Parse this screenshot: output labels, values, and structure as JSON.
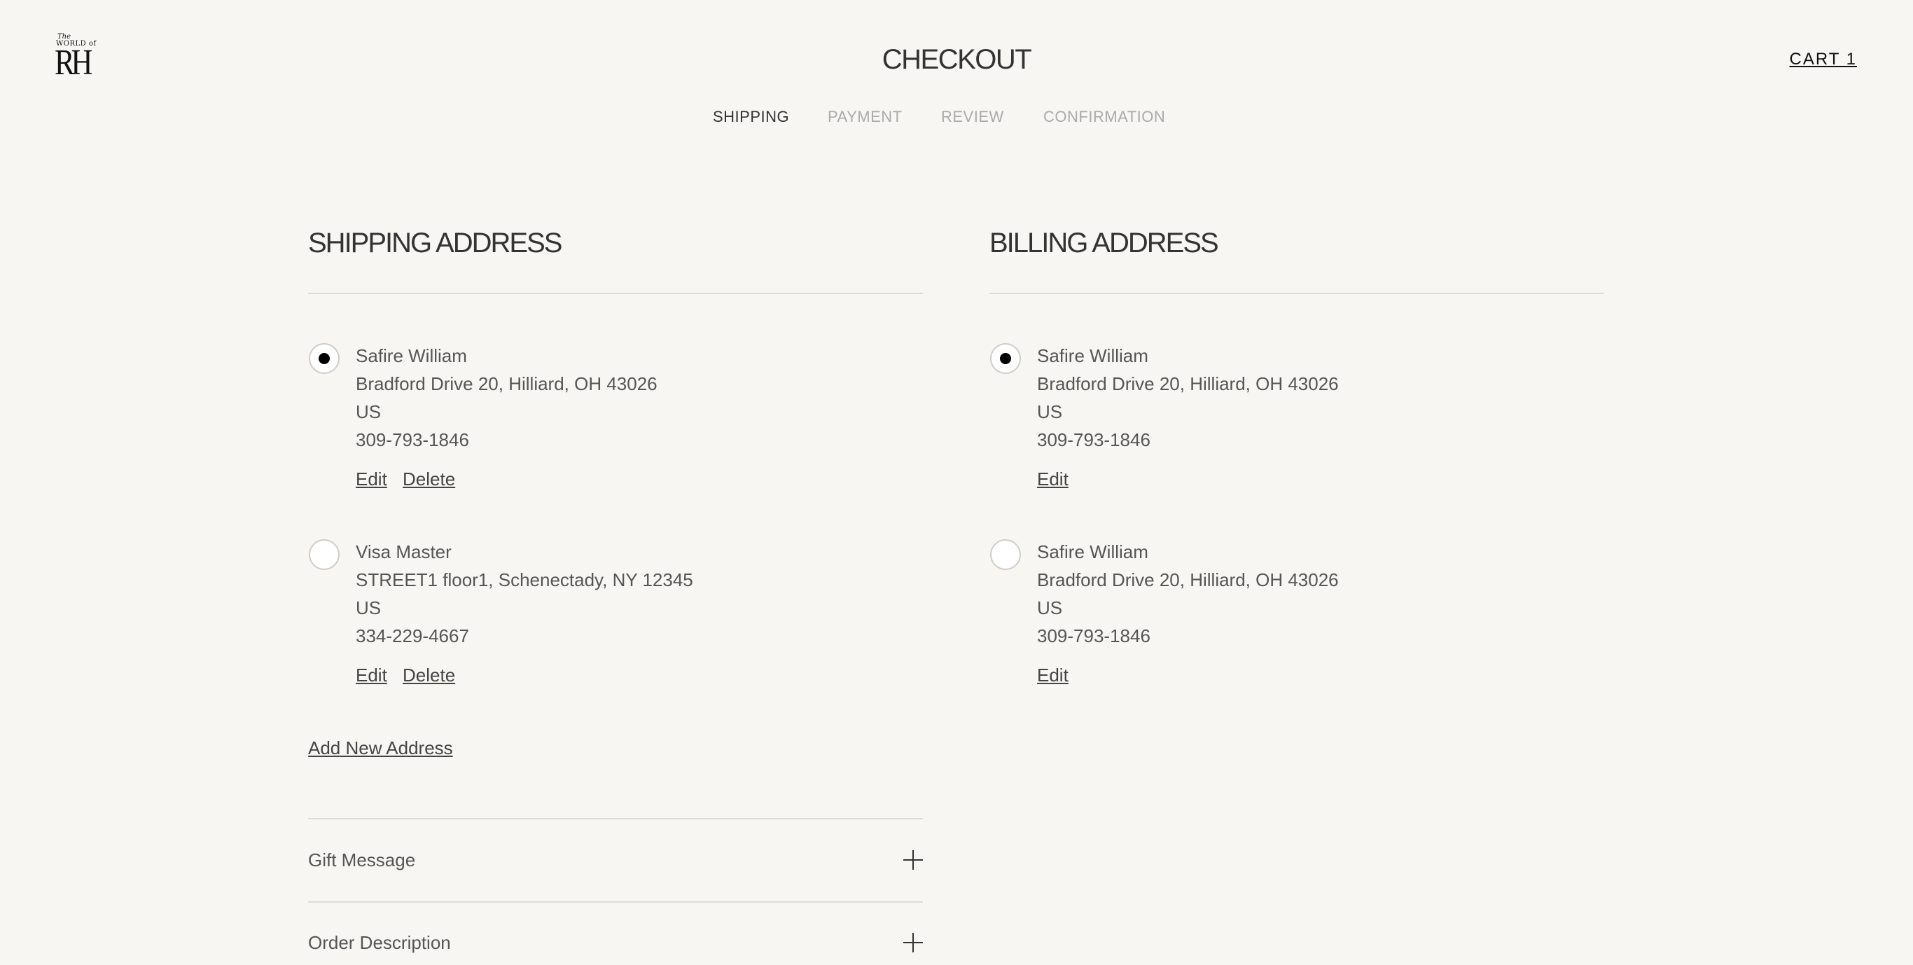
{
  "brand": {
    "logo_line1": "The",
    "logo_line2": "WORLD of",
    "logo_mark": "RH"
  },
  "header": {
    "title": "CHECKOUT",
    "cart_label": "CART 1"
  },
  "steps": [
    "SHIPPING",
    "PAYMENT",
    "REVIEW",
    "CONFIRMATION"
  ],
  "active_step": "SHIPPING",
  "shipping": {
    "title": "SHIPPING ADDRESS",
    "addresses": [
      {
        "selected": true,
        "name": "Safire William",
        "street": "Bradford Drive 20, Hilliard, OH 43026",
        "country": "US",
        "phone": "309-793-1846",
        "edit_label": "Edit",
        "delete_label": "Delete"
      },
      {
        "selected": false,
        "name": "Visa Master",
        "street": "STREET1 floor1, Schenectady, NY 12345",
        "country": "US",
        "phone": "334-229-4667",
        "edit_label": "Edit",
        "delete_label": "Delete"
      }
    ],
    "add_new_label": "Add New Address"
  },
  "billing": {
    "title": "BILLING ADDRESS",
    "addresses": [
      {
        "selected": true,
        "name": "Safire William",
        "street": "Bradford Drive 20, Hilliard, OH 43026",
        "country": "US",
        "phone": "309-793-1846",
        "edit_label": "Edit"
      },
      {
        "selected": false,
        "name": "Safire William",
        "street": "Bradford Drive 20, Hilliard, OH 43026",
        "country": "US",
        "phone": "309-793-1846",
        "edit_label": "Edit"
      }
    ]
  },
  "accordions": [
    {
      "label": "Gift Message",
      "icon": "plus-icon"
    },
    {
      "label": "Order Description",
      "icon": "plus-icon"
    }
  ]
}
